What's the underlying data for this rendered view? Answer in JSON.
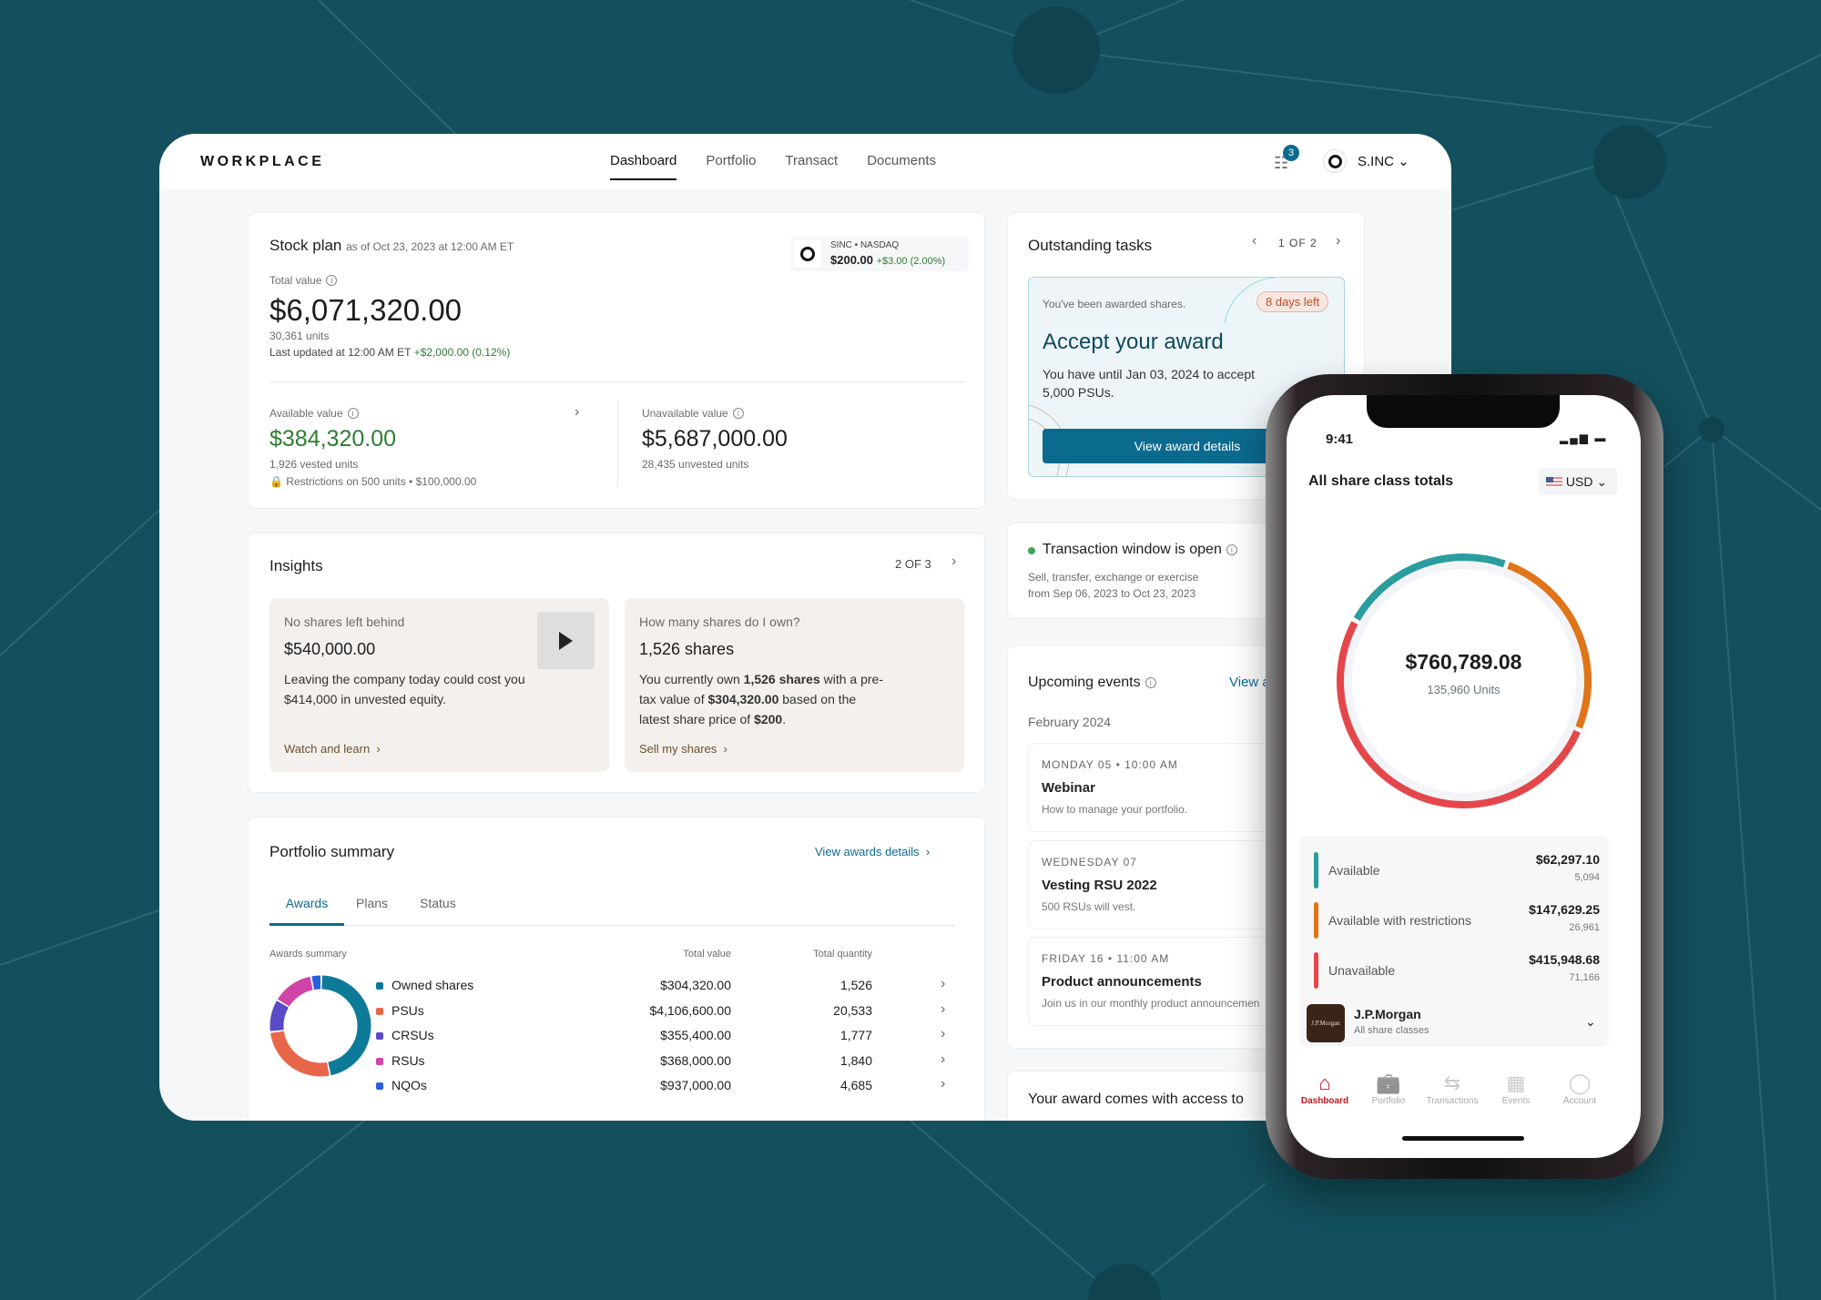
{
  "colors": {
    "background": "#134f5c",
    "accent": "#0b6b8f",
    "positive": "#2e7d32",
    "teal": "#2a9d9f",
    "orange": "#e07418",
    "red": "#e4474b"
  },
  "header": {
    "logo": "WORKPLACE",
    "nav": [
      "Dashboard",
      "Portfolio",
      "Transact",
      "Documents"
    ],
    "active_nav": "Dashboard",
    "tasks_badge": "3",
    "account": "S.INC"
  },
  "stock_plan": {
    "title": "Stock plan",
    "as_of": "as of Oct 23, 2023 at 12:00 AM ET",
    "ticker": "SINC • NASDAQ",
    "price": "$200.00",
    "price_change": "+$3.00 (2.00%)",
    "total_label": "Total value",
    "total_value": "$6,071,320.00",
    "units": "30,361 units",
    "last_updated": "Last updated at 12:00 AM ET",
    "last_change": "+$2,000.00 (0.12%)",
    "available_label": "Available value",
    "available_value": "$384,320.00",
    "vested": "1,926 vested units",
    "restrictions": "Restrictions on 500 units • $100,000.00",
    "unavailable_label": "Unavailable value",
    "unavailable_value": "$5,687,000.00",
    "unvested": "28,435 unvested units"
  },
  "insights": {
    "title": "Insights",
    "pager": "2 OF 3",
    "tiles": [
      {
        "eyebrow": "No shares left behind",
        "headline": "$540,000.00",
        "body": "Leaving the company today could cost you $414,000 in unvested equity.",
        "link": "Watch and learn"
      },
      {
        "eyebrow": "How many shares do I own?",
        "headline": "1,526 shares",
        "body_parts": [
          "You currently own ",
          "1,526 shares",
          " with a pre-tax value of ",
          "$304,320.00",
          " based on the latest share price of ",
          "$200",
          "."
        ],
        "link": "Sell my shares"
      }
    ]
  },
  "portfolio": {
    "title": "Portfolio summary",
    "link": "View awards details",
    "tabs": [
      "Awards",
      "Plans",
      "Status"
    ],
    "active_tab": "Awards",
    "col_name": "Awards summary",
    "col_value": "Total value",
    "col_qty": "Total quantity",
    "rows": [
      {
        "name": "Owned shares",
        "value": "$304,320.00",
        "qty": "1,526",
        "color": "#0e7a9a"
      },
      {
        "name": "PSUs",
        "value": "$4,106,600.00",
        "qty": "20,533",
        "color": "#e8674a"
      },
      {
        "name": "CRSUs",
        "value": "$355,400.00",
        "qty": "1,777",
        "color": "#5b4bc9"
      },
      {
        "name": "RSUs",
        "value": "$368,000.00",
        "qty": "1,840",
        "color": "#cf44a8"
      },
      {
        "name": "NQOs",
        "value": "$937,000.00",
        "qty": "4,685",
        "color": "#2a5fdc"
      }
    ]
  },
  "tasks": {
    "title": "Outstanding tasks",
    "pager": "1 OF 2",
    "eyebrow": "You've been awarded shares.",
    "badge": "8 days left",
    "headline": "Accept your award",
    "body": "You have until Jan 03, 2024 to accept 5,000 PSUs.",
    "button": "View award details"
  },
  "transaction_window": {
    "title": "Transaction window is open",
    "body1": "Sell, transfer, exchange or exercise",
    "body2": "from Sep 06, 2023 to Oct 23, 2023"
  },
  "events": {
    "title": "Upcoming events",
    "link": "View a",
    "month": "February 2024",
    "items": [
      {
        "date": "MONDAY 05 • 10:00 AM",
        "title": "Webinar",
        "desc": "How to manage your portfolio."
      },
      {
        "date": "WEDNESDAY 07",
        "title": "Vesting RSU 2022",
        "desc": "500 RSUs will vest."
      },
      {
        "date": "FRIDAY 16 • 11:00 AM",
        "title": "Product announcements",
        "desc": "Join us in our monthly product announcemen"
      }
    ]
  },
  "award_access": {
    "title": "Your award comes with access to"
  },
  "phone": {
    "time": "9:41",
    "title": "All share class totals",
    "currency": "USD",
    "total": "$760,789.08",
    "units": "135,960 Units",
    "legend": [
      {
        "label": "Available",
        "value": "$62,297.10",
        "units": "5,094",
        "color": "#2a9d9f"
      },
      {
        "label": "Available with restrictions",
        "value": "$147,629.25",
        "units": "26,961",
        "color": "#e07418"
      },
      {
        "label": "Unavailable",
        "value": "$415,948.68",
        "units": "71,166",
        "color": "#e4474b"
      }
    ],
    "broker": {
      "name": "J.P.Morgan",
      "sub": "All share classes",
      "logo_text": "J.P.Morgan"
    },
    "tabs": [
      {
        "label": "Dashboard",
        "icon": "home-icon"
      },
      {
        "label": "Portfolio",
        "icon": "briefcase-icon"
      },
      {
        "label": "Transactions",
        "icon": "arrows-icon"
      },
      {
        "label": "Events",
        "icon": "calendar-icon"
      },
      {
        "label": "Account",
        "icon": "user-icon"
      }
    ],
    "active_tab": "Dashboard"
  }
}
